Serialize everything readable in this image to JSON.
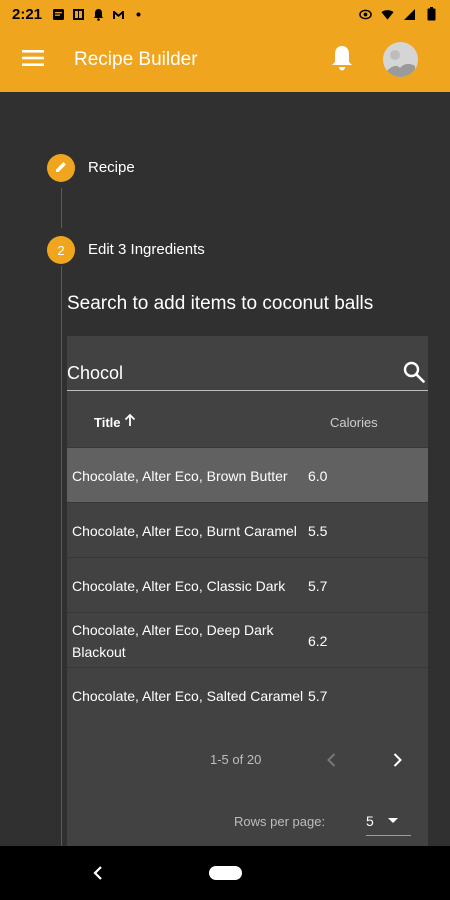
{
  "status_bar": {
    "time": "2:21",
    "left_icons": [
      "message-icon",
      "news-icon",
      "notification-icon",
      "gmail-icon",
      "dot-icon"
    ],
    "right_icons": [
      "vibrate-icon",
      "wifi-icon",
      "signal-icon",
      "battery-icon"
    ]
  },
  "app_bar": {
    "title": "Recipe Builder",
    "menu_icon": "hamburger-menu-icon",
    "bell_icon": "bell-icon",
    "avatar_icon": "avatar"
  },
  "stepper": {
    "steps": [
      {
        "label": "Recipe",
        "badge": "",
        "icon": "pencil-icon"
      },
      {
        "label": "Edit 3 Ingredients",
        "badge": "2"
      }
    ],
    "accent_color": "#F0A51F"
  },
  "search": {
    "heading": "Search to add items to coconut balls",
    "value": "Chocol",
    "icon": "search-icon"
  },
  "table": {
    "columns": {
      "title": "Title",
      "calories": "Calories"
    },
    "sort_icon": "arrow-up-icon",
    "rows": [
      {
        "title": "Chocolate, Alter Eco, Brown Butter",
        "calories": "6.0",
        "selected": true
      },
      {
        "title": "Chocolate, Alter Eco, Burnt Caramel",
        "calories": "5.5"
      },
      {
        "title": "Chocolate, Alter Eco, Classic Dark",
        "calories": "5.7"
      },
      {
        "title": "Chocolate, Alter Eco, Deep Dark Blackout",
        "calories": "6.2"
      },
      {
        "title": "Chocolate, Alter Eco, Salted Caramel",
        "calories": "5.7"
      }
    ]
  },
  "pagination": {
    "range": "1-5 of 20",
    "rows_per_page_label": "Rows per page:",
    "rows_per_page_value": "5",
    "prev_icon": "chevron-left-icon",
    "next_icon": "chevron-right-icon"
  },
  "nav_bar": {
    "back_icon": "back-icon",
    "home_icon": "home-pill-icon"
  }
}
